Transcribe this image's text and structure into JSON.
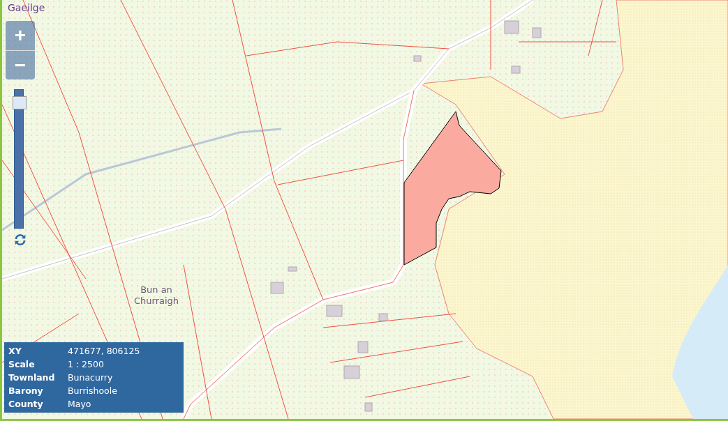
{
  "language_link": "Gaeilge",
  "zoom": {
    "in": "+",
    "out": "−",
    "level": 0.95
  },
  "map_label": "Bun an Churraigh",
  "info": [
    {
      "label": "XY",
      "value": "471677, 806125"
    },
    {
      "label": "Scale",
      "value": "1 : 2500"
    },
    {
      "label": "Townland",
      "value": "Bunacurry"
    },
    {
      "label": "Barony",
      "value": "Burrishoole"
    },
    {
      "label": "County",
      "value": "Mayo"
    }
  ]
}
